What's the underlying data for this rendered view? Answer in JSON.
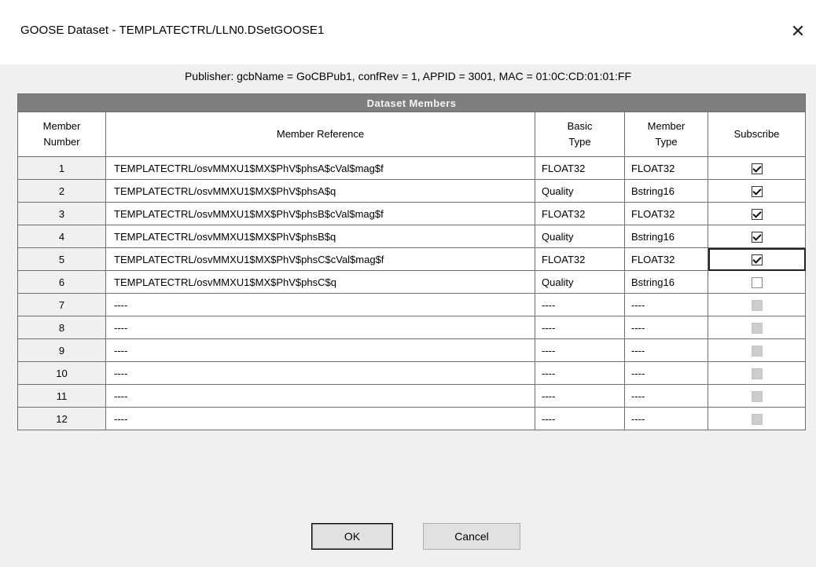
{
  "window": {
    "title": "GOOSE Dataset - TEMPLATECTRL/LLN0.DSetGOOSE1",
    "close_glyph": "✕"
  },
  "publisher": "Publisher: gcbName = GoCBPub1, confRev = 1, APPID = 3001, MAC = 01:0C:CD:01:01:FF",
  "table": {
    "banner": "Dataset Members",
    "headers": {
      "member_number": [
        "Member",
        "Number"
      ],
      "member_reference": "Member Reference",
      "basic_type": [
        "Basic",
        "Type"
      ],
      "member_type": [
        "Member",
        "Type"
      ],
      "subscribe": "Subscribe"
    },
    "rows": [
      {
        "num": "1",
        "ref": "TEMPLATECTRL/osvMMXU1$MX$PhV$phsA$cVal$mag$f",
        "basic": "FLOAT32",
        "mtype": "FLOAT32",
        "subscribe": "checked"
      },
      {
        "num": "2",
        "ref": "TEMPLATECTRL/osvMMXU1$MX$PhV$phsA$q",
        "basic": "Quality",
        "mtype": "Bstring16",
        "subscribe": "checked"
      },
      {
        "num": "3",
        "ref": "TEMPLATECTRL/osvMMXU1$MX$PhV$phsB$cVal$mag$f",
        "basic": "FLOAT32",
        "mtype": "FLOAT32",
        "subscribe": "checked"
      },
      {
        "num": "4",
        "ref": "TEMPLATECTRL/osvMMXU1$MX$PhV$phsB$q",
        "basic": "Quality",
        "mtype": "Bstring16",
        "subscribe": "checked"
      },
      {
        "num": "5",
        "ref": "TEMPLATECTRL/osvMMXU1$MX$PhV$phsC$cVal$mag$f",
        "basic": "FLOAT32",
        "mtype": "FLOAT32",
        "subscribe": "checked",
        "selected": true
      },
      {
        "num": "6",
        "ref": "TEMPLATECTRL/osvMMXU1$MX$PhV$phsC$q",
        "basic": "Quality",
        "mtype": "Bstring16",
        "subscribe": "unchecked"
      },
      {
        "num": "7",
        "ref": "----",
        "basic": "----",
        "mtype": "----",
        "subscribe": "disabled"
      },
      {
        "num": "8",
        "ref": "----",
        "basic": "----",
        "mtype": "----",
        "subscribe": "disabled"
      },
      {
        "num": "9",
        "ref": "----",
        "basic": "----",
        "mtype": "----",
        "subscribe": "disabled"
      },
      {
        "num": "10",
        "ref": "----",
        "basic": "----",
        "mtype": "----",
        "subscribe": "disabled"
      },
      {
        "num": "11",
        "ref": "----",
        "basic": "----",
        "mtype": "----",
        "subscribe": "disabled"
      },
      {
        "num": "12",
        "ref": "----",
        "basic": "----",
        "mtype": "----",
        "subscribe": "disabled"
      }
    ]
  },
  "buttons": {
    "ok": "OK",
    "cancel": "Cancel"
  },
  "colors": {
    "banner_bg": "#7e7e7e",
    "window_bg": "#f0f0f0",
    "grid_bg": "#ffffff"
  }
}
